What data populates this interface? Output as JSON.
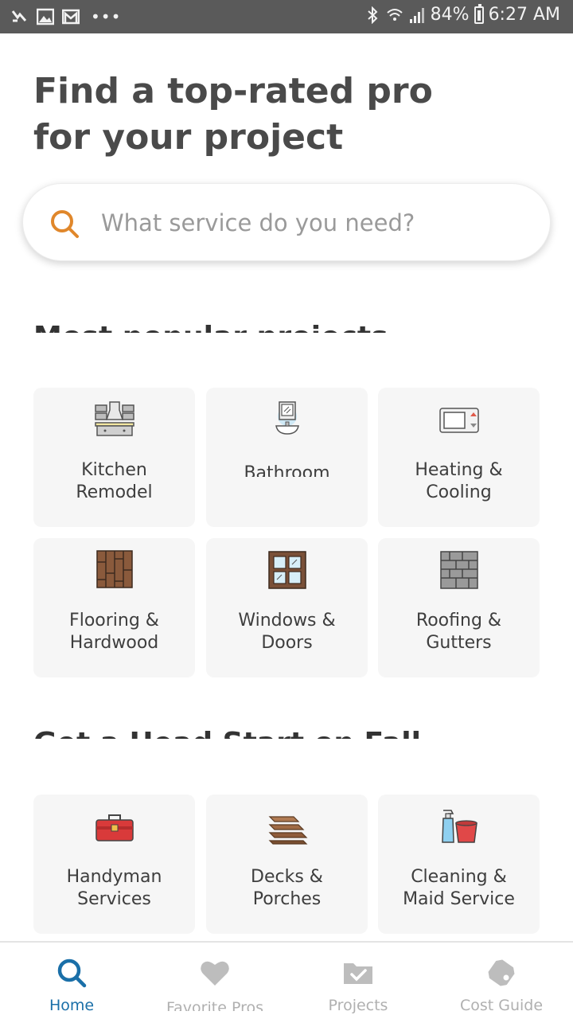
{
  "status_bar": {
    "battery": "84%",
    "time": "6:27 AM",
    "more": "•••"
  },
  "headline": "Find a top-rated pro\nfor your project",
  "search": {
    "placeholder": "What service do you need?"
  },
  "sections": [
    {
      "title": "Most popular projects",
      "tiles": [
        {
          "label": "Kitchen\nRemodel",
          "icon": "kitchen-icon"
        },
        {
          "label": "Bathroom",
          "icon": "bathroom-icon"
        },
        {
          "label": "Heating &\nCooling",
          "icon": "thermostat-icon"
        },
        {
          "label": "Flooring &\nHardwood",
          "icon": "flooring-icon"
        },
        {
          "label": "Windows &\nDoors",
          "icon": "window-icon"
        },
        {
          "label": "Roofing &\nGutters",
          "icon": "roofing-icon"
        }
      ]
    },
    {
      "title": "Get a Head Start on Fall",
      "tiles": [
        {
          "label": "Handyman\nServices",
          "icon": "toolbox-icon"
        },
        {
          "label": "Decks &\nPorches",
          "icon": "deck-icon"
        },
        {
          "label": "Cleaning &\nMaid Service",
          "icon": "cleaning-icon"
        }
      ]
    }
  ],
  "bottom_nav": [
    {
      "label": "Home",
      "icon": "search-icon",
      "active": true
    },
    {
      "label": "Favorite Pros",
      "icon": "heart-icon",
      "active": false
    },
    {
      "label": "Projects",
      "icon": "folder-check-icon",
      "active": false
    },
    {
      "label": "Cost Guide",
      "icon": "price-tag-icon",
      "active": false
    }
  ],
  "colors": {
    "status_bar": "#5a5a5a",
    "accent_active": "#1a6fa8",
    "search_icon": "#e0872b",
    "tile_bg": "#f6f6f6",
    "nav_inactive": "#b0b0b0"
  }
}
